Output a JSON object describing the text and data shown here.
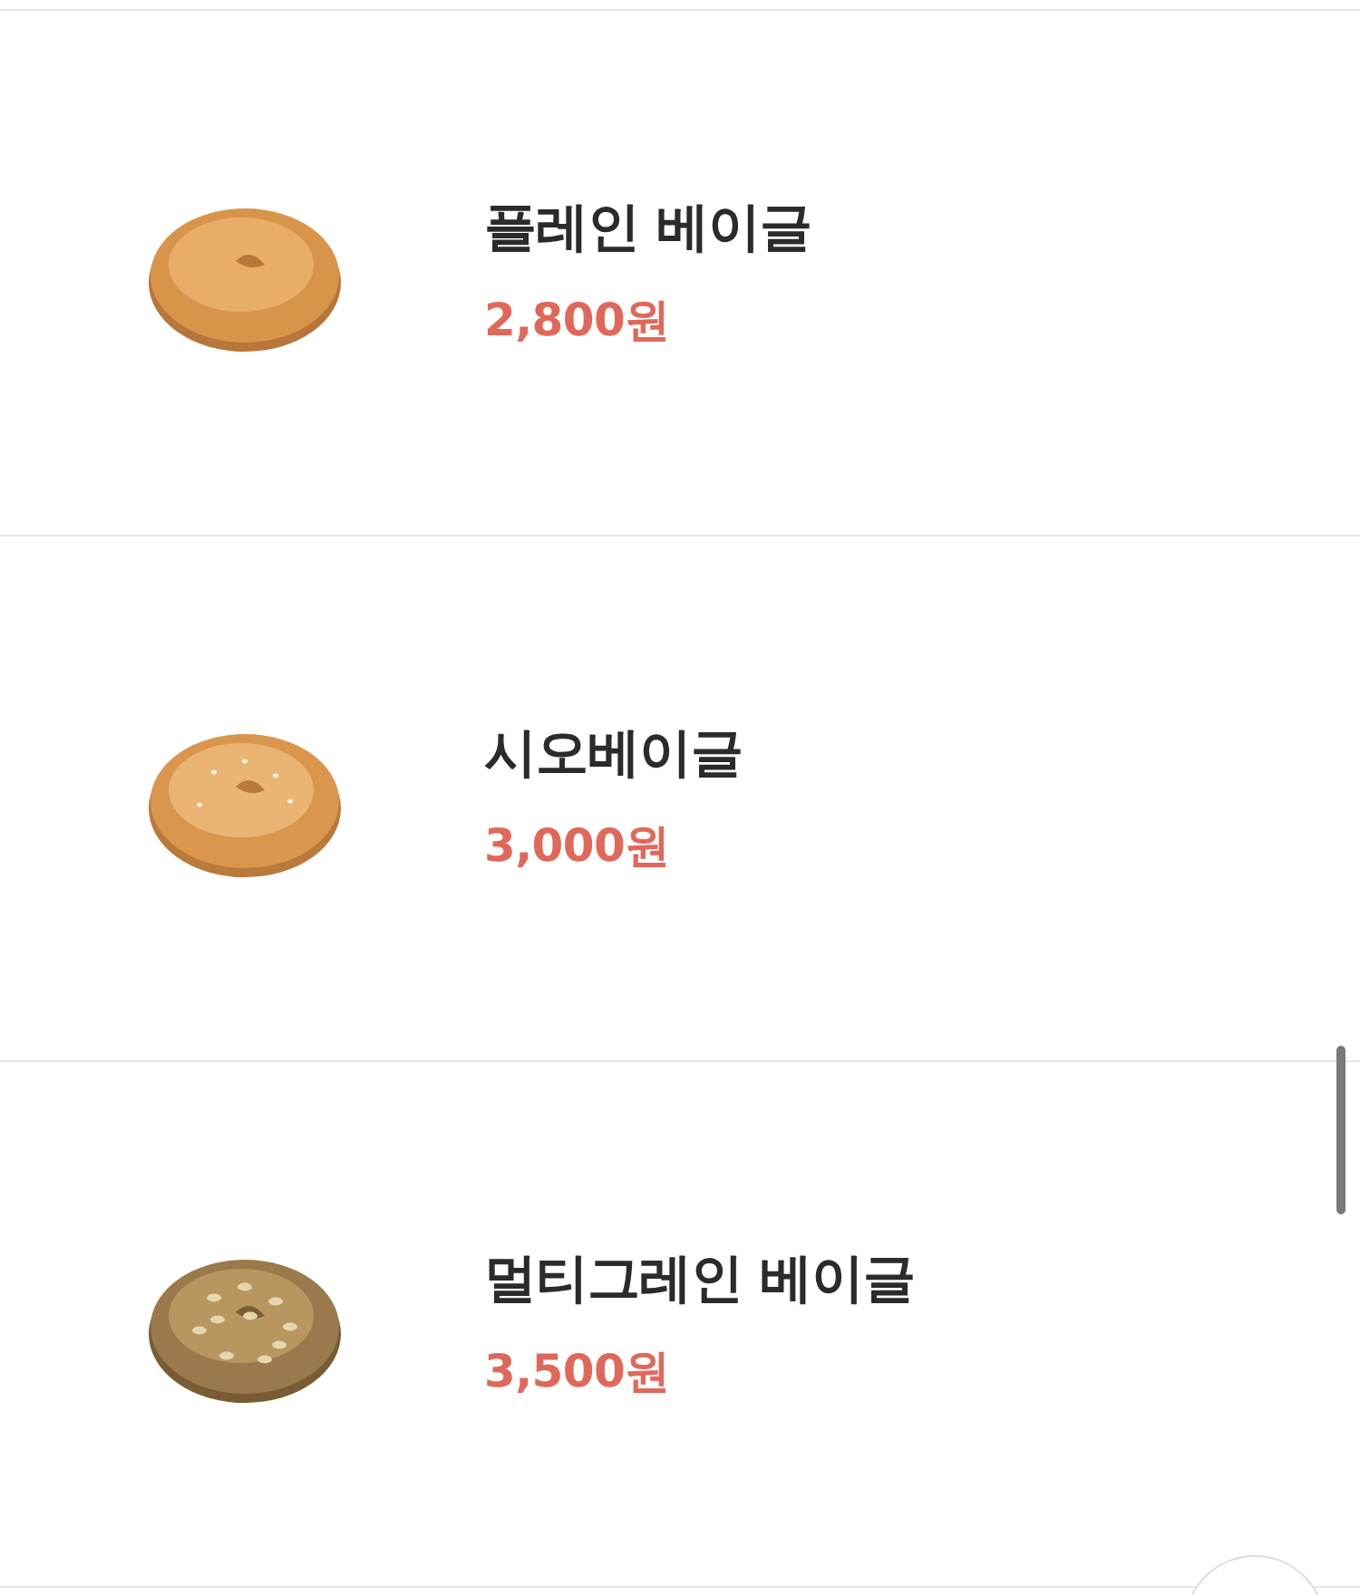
{
  "products": [
    {
      "name": "플레인 베이글",
      "price": "2,800원"
    },
    {
      "name": "시오베이글",
      "price": "3,000원"
    },
    {
      "name": "멀티그레인 베이글",
      "price": "3,500원"
    }
  ]
}
